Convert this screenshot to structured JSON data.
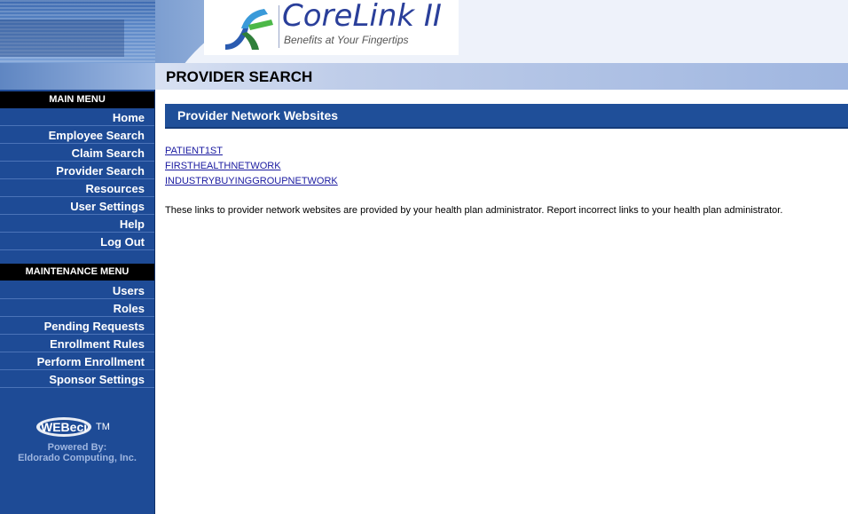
{
  "header": {
    "logo_title": "CoreLink II",
    "logo_tagline": "Benefits at Your Fingertips"
  },
  "page": {
    "title": "PROVIDER SEARCH"
  },
  "sidebar": {
    "main_menu_label": "MAIN MENU",
    "main_items": [
      {
        "label": "Home"
      },
      {
        "label": "Employee Search"
      },
      {
        "label": "Claim Search"
      },
      {
        "label": "Provider Search"
      },
      {
        "label": "Resources"
      },
      {
        "label": "User Settings"
      },
      {
        "label": "Help"
      },
      {
        "label": "Log Out"
      }
    ],
    "maintenance_menu_label": "MAINTENANCE MENU",
    "maintenance_items": [
      {
        "label": "Users"
      },
      {
        "label": "Roles"
      },
      {
        "label": "Pending Requests"
      },
      {
        "label": "Enrollment Rules"
      },
      {
        "label": "Perform Enrollment"
      },
      {
        "label": "Sponsor Settings"
      }
    ],
    "footer": {
      "brand": "WEBeci",
      "trademark": "TM",
      "powered_by": "Powered By:",
      "company": "Eldorado Computing, Inc."
    }
  },
  "main": {
    "section_title": "Provider Network Websites",
    "links": [
      "PATIENT1ST",
      "FIRSTHEALTHNETWORK",
      "INDUSTRYBUYINGGROUPNETWORK"
    ],
    "note": "These links to provider network websites are provided by your health plan administrator. Report incorrect links to your health plan administrator."
  },
  "colors": {
    "sidebar_bg": "#1e4b96",
    "section_header_bg": "#1f4f99",
    "link": "#1a1aa0",
    "logo_text": "#2a3f9a"
  }
}
